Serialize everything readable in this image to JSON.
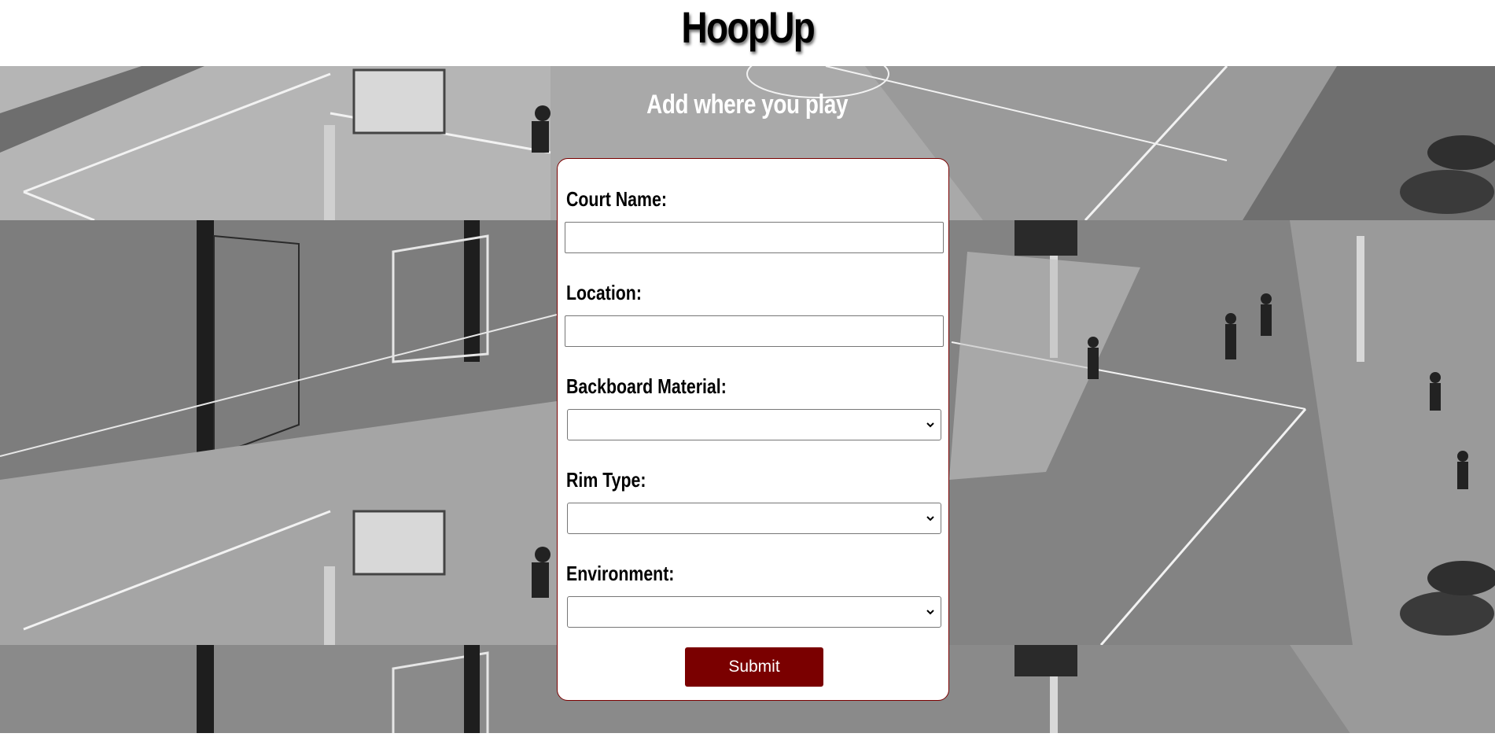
{
  "header": {
    "title": "HoopUp"
  },
  "hero": {
    "subtitle": "Add where you play"
  },
  "form": {
    "fields": [
      {
        "label": "Court Name:",
        "type": "text",
        "value": ""
      },
      {
        "label": "Location:",
        "type": "text",
        "value": ""
      },
      {
        "label": "Backboard Material:",
        "type": "select",
        "value": ""
      },
      {
        "label": "Rim Type:",
        "type": "select",
        "value": ""
      },
      {
        "label": "Environment:",
        "type": "select",
        "value": ""
      }
    ],
    "submit_label": "Submit"
  },
  "colors": {
    "accent": "#7a0000",
    "header_bg": "#ffffff",
    "subtitle_text": "#ffffff"
  },
  "background_image": {
    "description_icon": "basketball-court-photo",
    "tone": "grayscale"
  }
}
